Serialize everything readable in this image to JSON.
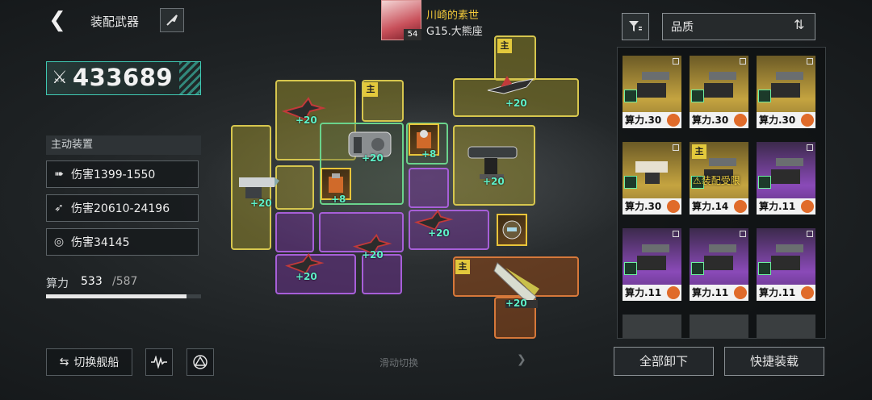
{
  "header": {
    "back_icon": "back-arrow-icon",
    "title": "装配武器",
    "commander_name": "川崎的素世",
    "commander_level": "54",
    "ship_name": "G15.大熊座"
  },
  "power": {
    "value": "433689"
  },
  "active": {
    "header": "主动装置",
    "stats": [
      {
        "icon": "dash-icon",
        "text": "伤害1399-1550"
      },
      {
        "icon": "missile-icon",
        "text": "伤害20610-24196"
      },
      {
        "icon": "target-icon",
        "text": "伤害34145"
      }
    ]
  },
  "capacity": {
    "label": "算力",
    "used": "533",
    "total": "/587",
    "fraction": 0.908
  },
  "buttons": {
    "switch_ship": "切换舰船",
    "swipe_hint": "滑动切换",
    "unequip_all": "全部卸下",
    "quick_equip": "快捷装载"
  },
  "filter": {
    "sort_label": "品质"
  },
  "grid": {
    "main_tag": "主",
    "bonuses": [
      "+20",
      "+20",
      "+20",
      "+20",
      "+20",
      "+20",
      "+20",
      "+20",
      "+20",
      "+8",
      "+8"
    ]
  },
  "inventory": {
    "equip_limit_label": "装配受限",
    "cards": [
      {
        "cost": "算力.30",
        "rarity": "gold"
      },
      {
        "cost": "算力.30",
        "rarity": "gold"
      },
      {
        "cost": "算力.30",
        "rarity": "gold"
      },
      {
        "cost": "算力.30",
        "rarity": "gold"
      },
      {
        "cost": "算力.14",
        "rarity": "gold",
        "main": "主"
      },
      {
        "cost": "算力.11",
        "rarity": "purple"
      },
      {
        "cost": "算力.11",
        "rarity": "purple"
      },
      {
        "cost": "算力.11",
        "rarity": "purple"
      },
      {
        "cost": "算力.11",
        "rarity": "purple"
      }
    ]
  },
  "colors": {
    "accent": "#3fc9b3",
    "gold": "#e3c93c",
    "purple": "#a75fd8",
    "orange": "#d6783a"
  }
}
